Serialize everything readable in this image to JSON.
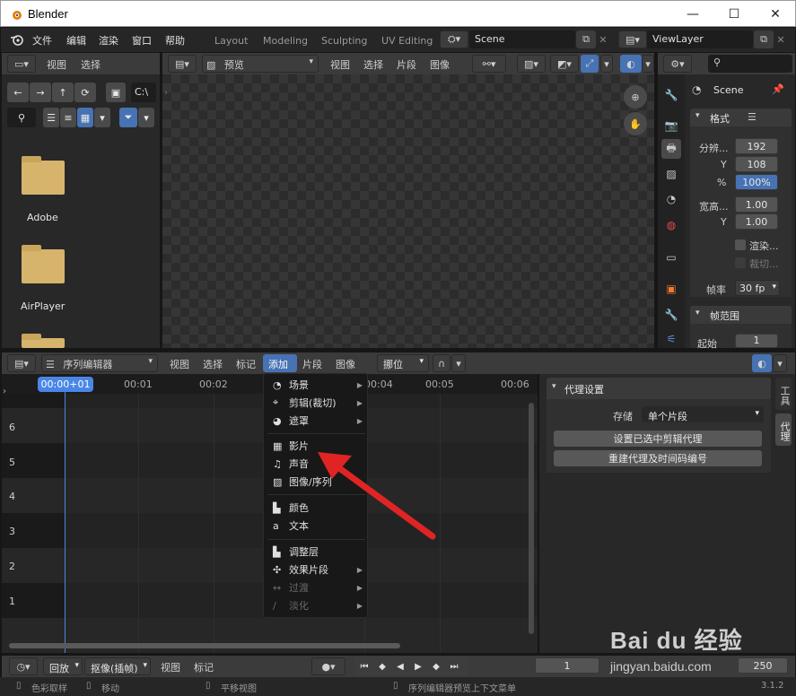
{
  "window": {
    "title": "Blender",
    "min_glyph": "—",
    "max_glyph": "☐",
    "close_glyph": "✕"
  },
  "topbar": {
    "menus": [
      "文件",
      "编辑",
      "渲染",
      "窗口",
      "帮助"
    ],
    "workspaces": [
      "Layout",
      "Modeling",
      "Sculpting",
      "UV Editing"
    ],
    "scene": "Scene",
    "view_layer": "ViewLayer"
  },
  "file_browser": {
    "header": [
      "视图",
      "选择"
    ],
    "path": "C:\\",
    "folders": [
      "Adobe",
      "AirPlayer"
    ]
  },
  "preview": {
    "mode": "预览",
    "header": [
      "视图",
      "选择",
      "片段",
      "图像"
    ]
  },
  "properties": {
    "scene_name": "Scene",
    "format_title": "格式",
    "res_x_label": "分辨...",
    "res_x": "192",
    "res_y_label": "Y",
    "res_y": "108",
    "pct_label": "%",
    "pct": "100%",
    "aspect_label": "宽高...",
    "aspect_x": "1.00",
    "aspect_y_label": "Y",
    "aspect_y": "1.00",
    "render_region": "渲染...",
    "crop": "裁切...",
    "fps_label": "帧率",
    "fps": "30 fp",
    "frame_range_title": "帧范围",
    "start_label": "起始",
    "start": "1"
  },
  "sequencer": {
    "editor_type": "序列编辑器",
    "header": [
      "视图",
      "选择",
      "标记",
      "添加",
      "片段",
      "图像"
    ],
    "pivot": "挪位",
    "time_labels": [
      "00:00+01",
      "00:01",
      "00:02",
      "00:04",
      "00:05",
      "00:06"
    ],
    "channels": [
      "6",
      "5",
      "4",
      "3",
      "2",
      "1"
    ]
  },
  "add_menu": {
    "items": [
      {
        "label": "场景",
        "icon": "scene-icon",
        "glyph": "◔",
        "submenu": true
      },
      {
        "label": "剪辑(裁切)",
        "icon": "clip-icon",
        "glyph": "⌖",
        "submenu": true
      },
      {
        "label": "遮罩",
        "icon": "mask-icon",
        "glyph": "◕",
        "submenu": true
      },
      {
        "label": "影片",
        "icon": "movie-icon",
        "glyph": "▦",
        "submenu": false
      },
      {
        "label": "声音",
        "icon": "sound-icon",
        "glyph": "♫",
        "submenu": false
      },
      {
        "label": "图像/序列",
        "icon": "image-icon",
        "glyph": "▨",
        "submenu": false
      },
      {
        "label": "颜色",
        "icon": "color-icon",
        "glyph": "▙",
        "submenu": false
      },
      {
        "label": "文本",
        "icon": "text-icon",
        "glyph": "a",
        "submenu": false
      },
      {
        "label": "调整层",
        "icon": "adjustment-icon",
        "glyph": "▙",
        "submenu": false
      },
      {
        "label": "效果片段",
        "icon": "effect-icon",
        "glyph": "✣",
        "submenu": true
      },
      {
        "label": "过渡",
        "icon": "transition-icon",
        "glyph": "↔",
        "submenu": true,
        "disabled": true
      },
      {
        "label": "淡化",
        "icon": "fade-icon",
        "glyph": "∕",
        "submenu": true,
        "disabled": true
      }
    ]
  },
  "proxy_panel": {
    "title": "代理设置",
    "storage_label": "存储",
    "storage_value": "单个片段",
    "btn_set": "设置已选中剪辑代理",
    "btn_rebuild": "重建代理及时间码编号",
    "tab_tool": "工具",
    "tab_proxy": "代理"
  },
  "timeline": {
    "playback": "回放",
    "keying": "抠像(插帧)",
    "view": "视图",
    "marker": "标记",
    "current_frame": "1",
    "end_frame": "250"
  },
  "statusbar": {
    "items": [
      "色彩取样",
      "移动",
      "平移视图",
      "序列编辑器预览上下文菜单"
    ],
    "version": "3.1.2"
  },
  "watermark": {
    "brand": "Bai du 经验",
    "url": "jingyan.baidu.com"
  },
  "colors": {
    "accent_blue": "#4772b3",
    "playhead": "#4a86e8",
    "arrow_red": "#e02424",
    "folder": "#d6b46c"
  }
}
